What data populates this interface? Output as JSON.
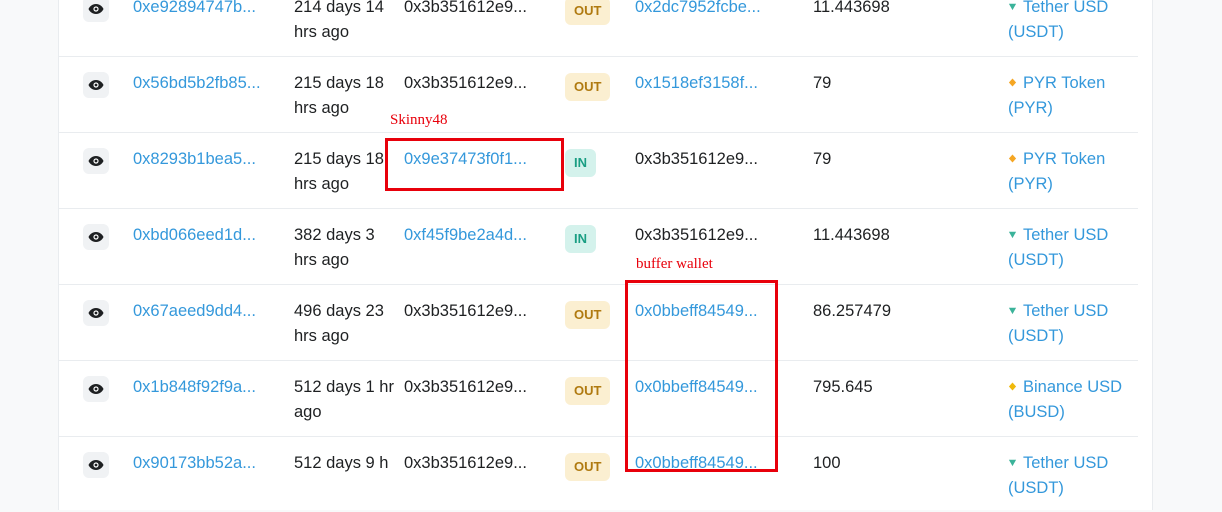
{
  "colors": {
    "link": "#3498db",
    "out_badge_bg": "#fbefd1",
    "out_badge_text": "#b07a10",
    "in_badge_bg": "#d4f2ec",
    "in_badge_text": "#1a9e83",
    "annotation": "#e8000b",
    "tether_icon": "#3bb39a",
    "pyr_icon": "#f5a623",
    "busd_icon": "#f0b90b"
  },
  "rows": [
    {
      "hash": "0xe92894747b...",
      "age": "214 days 14 hrs ago",
      "from": "0x3b351612e9...",
      "direction": "OUT",
      "to": "0x2dc7952fcbe...",
      "value": "11.443698",
      "token": "Tether USD (USDT)",
      "token_icon": "tether-icon"
    },
    {
      "hash": "0x56bd5b2fb85...",
      "age": "215 days 18 hrs ago",
      "from": "0x3b351612e9...",
      "direction": "OUT",
      "to": "0x1518ef3158f...",
      "value": "79",
      "token": "PYR Token (PYR)",
      "token_icon": "pyr-icon"
    },
    {
      "hash": "0x8293b1bea5...",
      "age": "215 days 18 hrs ago",
      "from": "0x9e37473f0f1...",
      "direction": "IN",
      "to": "0x3b351612e9...",
      "value": "79",
      "token": "PYR Token (PYR)",
      "token_icon": "pyr-icon"
    },
    {
      "hash": "0xbd066eed1d...",
      "age": "382 days 3 hrs ago",
      "from": "0xf45f9be2a4d...",
      "direction": "IN",
      "to": "0x3b351612e9...",
      "value": "11.443698",
      "token": "Tether USD (USDT)",
      "token_icon": "tether-icon"
    },
    {
      "hash": "0x67aeed9dd4...",
      "age": "496 days 23 hrs ago",
      "from": "0x3b351612e9...",
      "direction": "OUT",
      "to": "0x0bbeff84549...",
      "value": "86.257479",
      "token": "Tether USD (USDT)",
      "token_icon": "tether-icon"
    },
    {
      "hash": "0x1b848f92f9a...",
      "age": "512 days 1 hr ago",
      "from": "0x3b351612e9...",
      "direction": "OUT",
      "to": "0x0bbeff84549...",
      "value": "795.645",
      "token": "Binance USD (BUSD)",
      "token_icon": "busd-icon"
    },
    {
      "hash": "0x90173bb52a...",
      "age": "512 days 9 h",
      "from": "0x3b351612e9...",
      "direction": "OUT",
      "to": "0x0bbeff84549...",
      "value": "100",
      "token": "Tether USD (USDT)",
      "token_icon": "tether-icon"
    }
  ],
  "annotations": {
    "skinny_label": "Skinny48",
    "buffer_label": "buffer wallet"
  }
}
